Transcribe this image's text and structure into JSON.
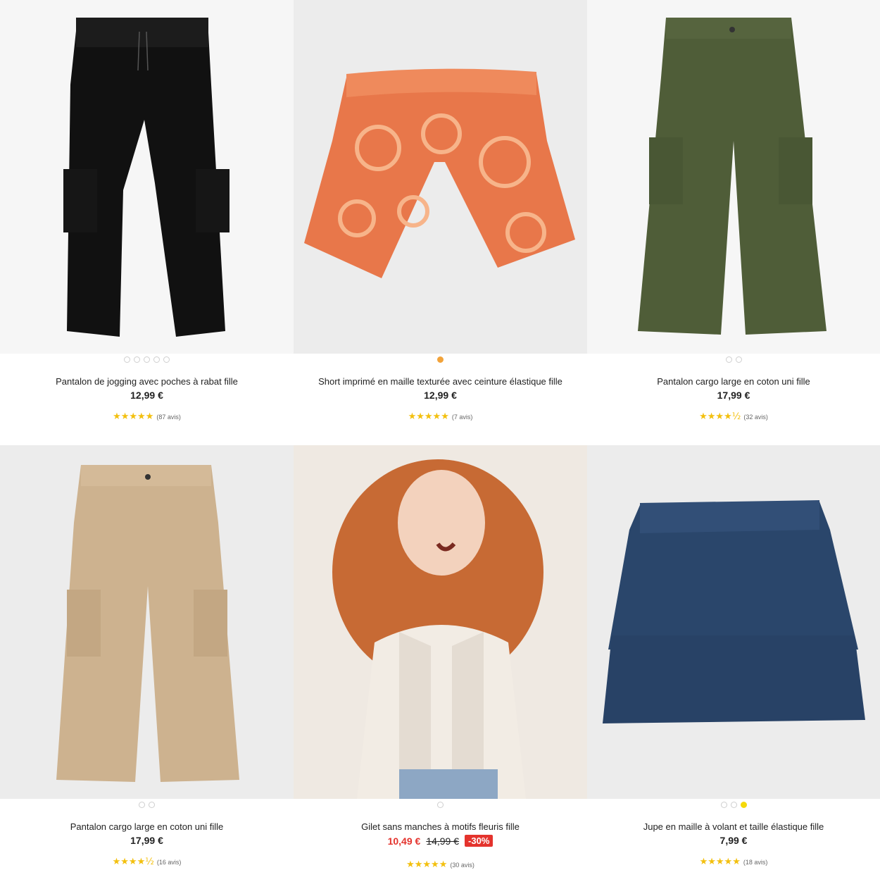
{
  "products": [
    {
      "title": "Pantalon de jogging avec poches à rabat fille",
      "price": "12,99 €",
      "stars": "★★★★★",
      "reviews": "(87 avis)",
      "image": "black-cargo-jogger",
      "dots": 5,
      "active_dot": -1
    },
    {
      "title": "Short imprimé en maille texturée avec ceinture élastique fille",
      "price": "12,99 €",
      "stars": "★★★★★",
      "reviews": "(7 avis)",
      "image": "orange-printed-shorts",
      "dots": 1,
      "active_dot": 0
    },
    {
      "title": "Pantalon cargo large en coton uni fille",
      "price": "17,99 €",
      "stars": "★★★★½",
      "reviews": "(32 avis)",
      "image": "khaki-cargo-pants",
      "dots": 2,
      "active_dot": -1
    },
    {
      "title": "Pantalon cargo large en coton uni fille",
      "price": "17,99 €",
      "stars": "★★★★½",
      "reviews": "(16 avis)",
      "image": "beige-cargo-pants",
      "dots": 2,
      "active_dot": -1
    },
    {
      "title": "Gilet sans manches à motifs fleuris fille",
      "price": "10,49 €",
      "old_price": "14,99 €",
      "discount": "-30%",
      "stars": "★★★★★",
      "reviews": "(30 avis)",
      "image": "girl-floral-vest-photo",
      "dots": 1,
      "active_dot": -1
    },
    {
      "title": "Jupe en maille à volant et taille élastique fille",
      "price": "7,99 €",
      "stars": "★★★★★",
      "reviews": "(18 avis)",
      "image": "navy-ruffle-skirt",
      "dots": 3,
      "active_dot": 2
    }
  ],
  "colors": {
    "star": "#f3c00f",
    "sale": "#e4332d",
    "dot_orange": "#f2a33a",
    "dot_yellow": "#f5d90a"
  }
}
